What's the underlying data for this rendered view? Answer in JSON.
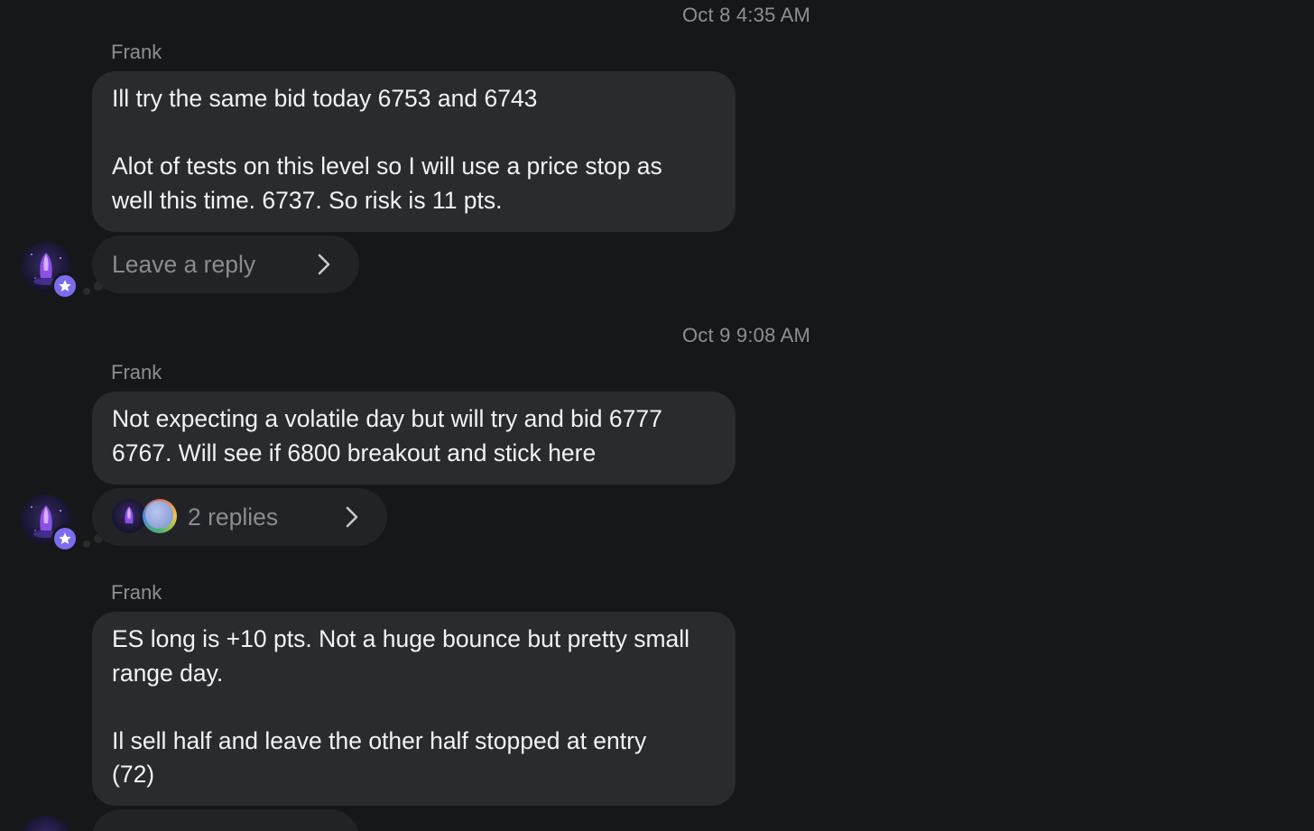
{
  "messages": [
    {
      "timestamp": "Oct 8 4:35 AM",
      "sender": "Frank",
      "paragraphs": [
        "Ill try the same bid today 6753 and 6743",
        "Alot of tests on this level so I will use a price stop as well this time. 6737. So risk is 11 pts."
      ],
      "reply_label": "Leave a reply"
    },
    {
      "timestamp": "Oct 9 9:08 AM",
      "sender": "Frank",
      "paragraphs": [
        "Not expecting a volatile day but will try and bid 6777 6767. Will see if 6800 breakout and stick here"
      ],
      "reply_label": "2 replies"
    },
    {
      "sender": "Frank",
      "paragraphs": [
        "ES long is +10 pts. Not a huge bounce but pretty small range day.",
        "Il sell half and leave the other half stopped at entry (72)"
      ]
    }
  ],
  "icons": {
    "chevron": "chevron-right-icon",
    "badge": "star-badge-icon"
  },
  "colors": {
    "background": "#161719",
    "bubble": "#2a2b2e",
    "badge": "#7b6df0",
    "muted_text": "#8e8f94"
  }
}
